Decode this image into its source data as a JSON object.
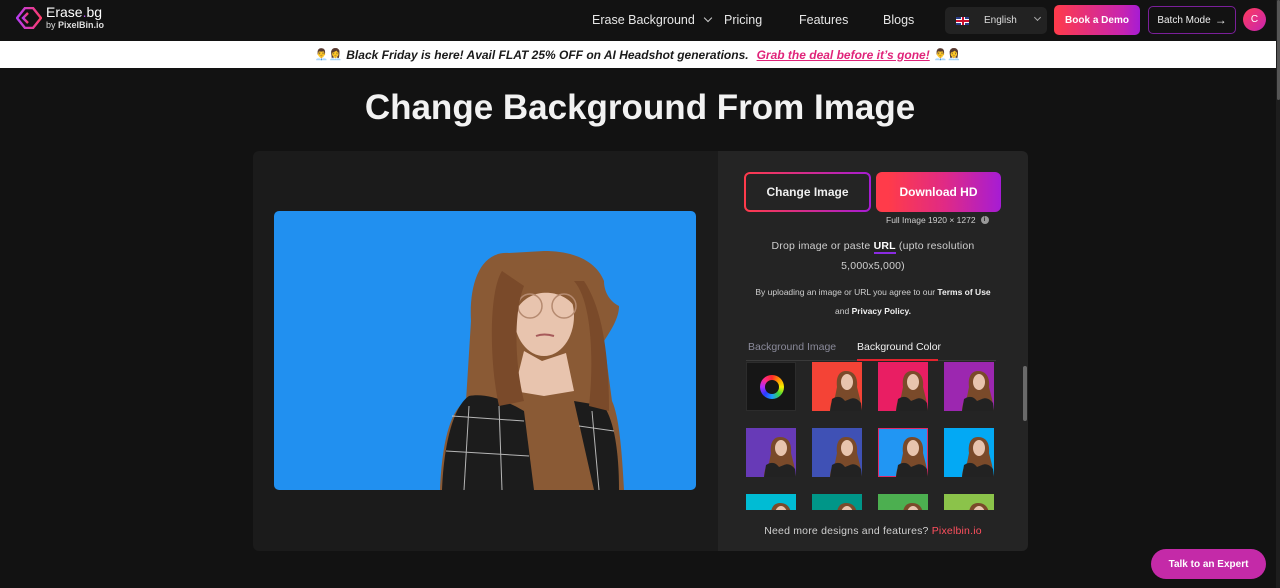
{
  "header": {
    "logo": {
      "title_main": "Erase",
      "title_dot": ".",
      "title_ext": "bg",
      "sub_by": "by",
      "sub_brand": "PixelBin.io"
    },
    "nav": [
      {
        "label": "Erase Background",
        "has_dropdown": true
      },
      {
        "label": "Pricing"
      },
      {
        "label": "Features"
      },
      {
        "label": "Blogs"
      }
    ],
    "language": {
      "flag": "uk-flag-icon",
      "label": "English"
    },
    "book_demo_label": "Book a Demo",
    "batch_mode_label": "Batch Mode",
    "batch_mode_icon": "→",
    "avatar_initial": "C"
  },
  "banner": {
    "emoji_left": "👨‍💼👩‍💼",
    "text": "Black Friday is here! Avail FLAT 25% OFF on AI Headshot generations.",
    "link": "Grab the deal before it’s gone!",
    "emoji_right": "👨‍💼👩‍💼"
  },
  "page_title": "Change Background From Image",
  "editor": {
    "preview_background_color": "#2190f0",
    "change_image_label": "Change Image",
    "download_label": "Download HD",
    "full_image_label": "Full Image 1920 × 1272",
    "info_icon": "i",
    "drop_text_before": "Drop image or paste ",
    "drop_url": "URL",
    "drop_text_after": " (upto resolution 5,000x5,000)",
    "terms_before": "By uploading an image or URL you agree to our ",
    "terms_link": "Terms of Use",
    "terms_and": " and ",
    "privacy_link": "Privacy Policy.",
    "tabs": [
      {
        "label": "Background Image",
        "active": false
      },
      {
        "label": "Background Color",
        "active": true
      }
    ],
    "swatches": [
      {
        "type": "picker"
      },
      {
        "color": "#f44336"
      },
      {
        "color": "#e91e63"
      },
      {
        "color": "#9c27b0"
      },
      {
        "color": "#673ab7"
      },
      {
        "color": "#3f51b5"
      },
      {
        "color": "#2196f3",
        "selected": true
      },
      {
        "color": "#03a9f4"
      },
      {
        "color": "#00bcd4"
      },
      {
        "color": "#009688"
      },
      {
        "color": "#4caf50"
      },
      {
        "color": "#8bc34a"
      }
    ],
    "more_text": "Need more designs and features? ",
    "more_link": "Pixelbin.io"
  },
  "talk_expert_label": "Talk to an Expert"
}
